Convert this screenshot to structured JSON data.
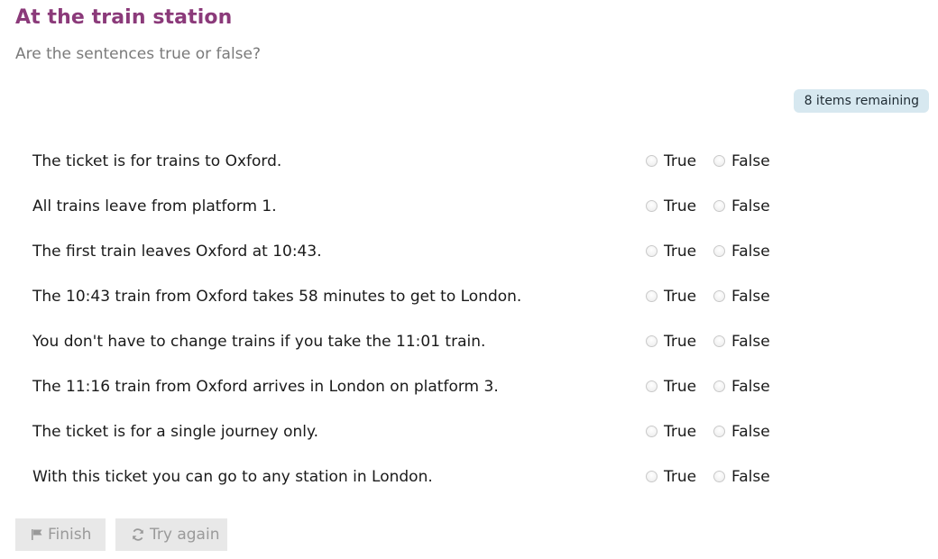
{
  "header": {
    "title": "At the train station",
    "subtitle": "Are the sentences true or false?"
  },
  "status": {
    "remaining": "8 items remaining"
  },
  "options": {
    "true_label": "True",
    "false_label": "False"
  },
  "statements": [
    "The ticket is for trains to Oxford.",
    "All trains leave from platform 1.",
    "The first train leaves Oxford at 10:43.",
    "The 10:43 train from Oxford takes 58 minutes to get to London.",
    "You don't have to change trains if you take the 11:01 train.",
    "The 11:16 train from Oxford arrives in London on platform 3.",
    "The ticket is for a single journey only.",
    "With this ticket you can go to any station in London."
  ],
  "buttons": {
    "finish": {
      "label": "Finish",
      "icon": "flag-icon"
    },
    "try_again": {
      "label": "Try again",
      "icon": "refresh-icon"
    }
  },
  "colors": {
    "title": "#8b3a7a",
    "badge_bg": "#d7e8f0",
    "button_bg": "#e8e8e8",
    "button_text": "#9a9a9a"
  }
}
